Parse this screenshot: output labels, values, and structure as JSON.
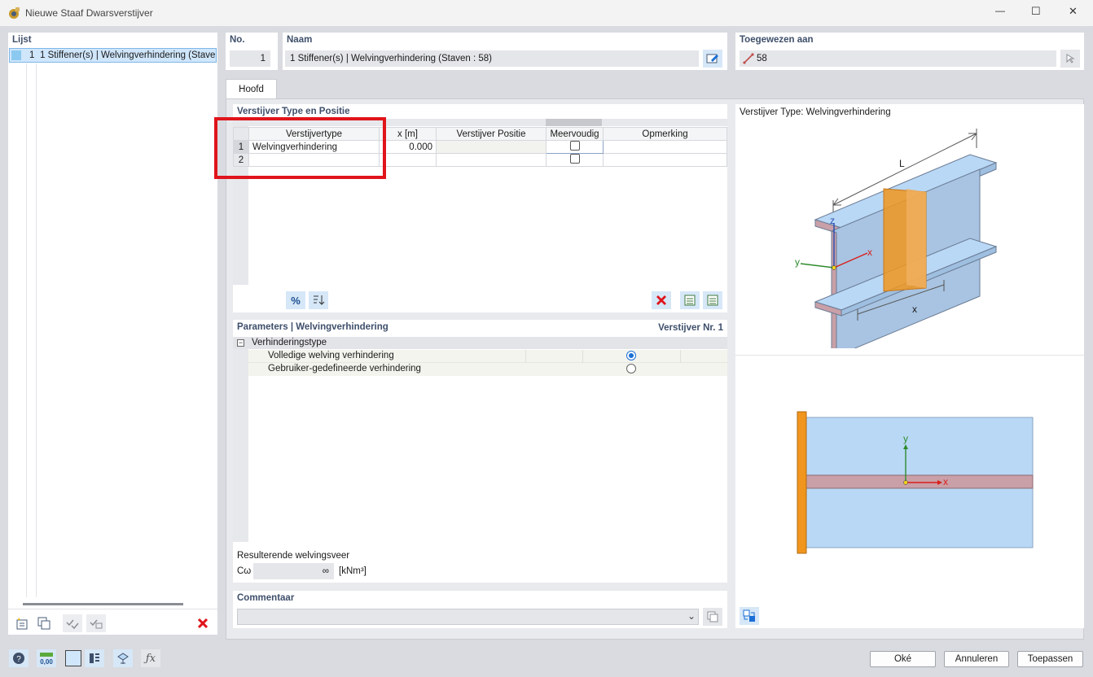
{
  "window": {
    "title": "Nieuwe Staaf Dwarsverstijver",
    "controls": {
      "minimize": "—",
      "maximize": "☐",
      "close": "✕"
    }
  },
  "list": {
    "title": "Lijst",
    "items": [
      {
        "no": "1",
        "label": "1 Stiffener(s) | Welvingverhindering (Staven : 58)"
      }
    ]
  },
  "header": {
    "no_label": "No.",
    "no_value": "1",
    "name_label": "Naam",
    "name_value": "1 Stiffener(s) | Welvingverhindering (Staven : 58)",
    "assigned_label": "Toegewezen aan",
    "assigned_value": "58"
  },
  "tabs": [
    {
      "label": "Hoofd",
      "active": true
    }
  ],
  "stiffener_table": {
    "title": "Verstijver Type en Positie",
    "columns": [
      "Verstijvertype",
      "x [m]",
      "Verstijver Positie",
      "Meervoudig",
      "Opmerking"
    ],
    "rows": [
      {
        "no": "1",
        "type": "Welvingverhindering",
        "x": "0.000",
        "position": "",
        "multiple": false,
        "remark": ""
      },
      {
        "no": "2",
        "type": "",
        "x": "",
        "position": "",
        "multiple": false,
        "remark": ""
      }
    ]
  },
  "parameters": {
    "title": "Parameters | Welvingverhindering",
    "stiffener_no": "Verstijver Nr. 1",
    "group": "Verhinderingstype",
    "options": [
      {
        "label": "Volledige welving verhindering",
        "selected": true
      },
      {
        "label": "Gebruiker-gedefineerde verhindering",
        "selected": false
      }
    ],
    "result_label": "Resulterende welvingsveer",
    "cw_symbol": "Cω",
    "cw_value": "∞",
    "cw_unit": "[kNm³]"
  },
  "comment": {
    "title": "Commentaar",
    "value": ""
  },
  "preview": {
    "title": "Verstijver Type: Welvingverhindering",
    "labels": {
      "L": "L",
      "x_dim": "x",
      "axis_x": "x",
      "axis_y": "y",
      "axis_z": "z"
    }
  },
  "buttons": {
    "ok": "Oké",
    "cancel": "Annuleren",
    "apply": "Toepassen"
  },
  "colors": {
    "accent": "#1a6fd6",
    "highlight_frame": "#e0141b",
    "stiffener": "#f0961e",
    "beam_fill": "#b9d8f6",
    "flange": "#c9a0a8"
  }
}
